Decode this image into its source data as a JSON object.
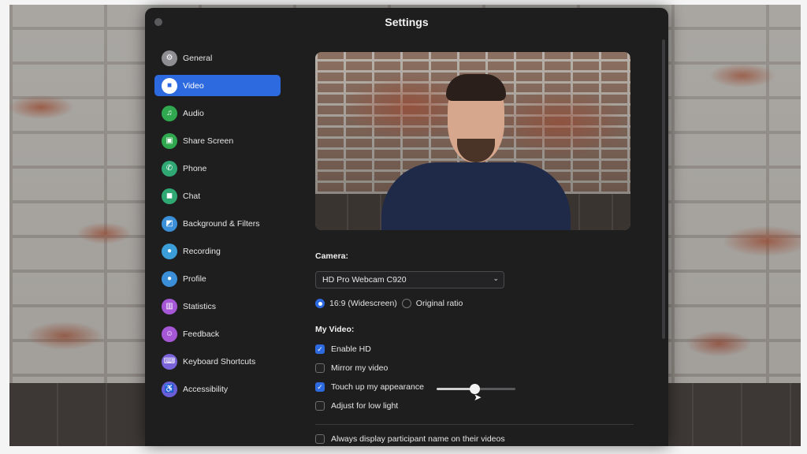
{
  "window": {
    "title": "Settings"
  },
  "sidebar": {
    "items": [
      {
        "label": "General",
        "icon": "gear-icon",
        "color": "#8e8e93",
        "glyph": "⚙",
        "active": false
      },
      {
        "label": "Video",
        "icon": "video-camera-icon",
        "color": "#2d6ae0",
        "glyph": "■",
        "active": true
      },
      {
        "label": "Audio",
        "icon": "headphones-icon",
        "color": "#2fa84f",
        "glyph": "♫",
        "active": false
      },
      {
        "label": "Share Screen",
        "icon": "share-screen-icon",
        "color": "#2fa84f",
        "glyph": "▣",
        "active": false
      },
      {
        "label": "Phone",
        "icon": "phone-icon",
        "color": "#2fa873",
        "glyph": "✆",
        "active": false
      },
      {
        "label": "Chat",
        "icon": "chat-bubble-icon",
        "color": "#2fa873",
        "glyph": "◼",
        "active": false
      },
      {
        "label": "Background & Filters",
        "icon": "person-background-icon",
        "color": "#3b8fd8",
        "glyph": "◩",
        "active": false
      },
      {
        "label": "Recording",
        "icon": "record-icon",
        "color": "#3b9ed8",
        "glyph": "●",
        "active": false
      },
      {
        "label": "Profile",
        "icon": "profile-icon",
        "color": "#3b8fd8",
        "glyph": "●",
        "active": false
      },
      {
        "label": "Statistics",
        "icon": "bar-chart-icon",
        "color": "#a557d6",
        "glyph": "▥",
        "active": false
      },
      {
        "label": "Feedback",
        "icon": "smiley-icon",
        "color": "#a557d6",
        "glyph": "☺",
        "active": false
      },
      {
        "label": "Keyboard Shortcuts",
        "icon": "keyboard-icon",
        "color": "#7a63d8",
        "glyph": "⌨",
        "active": false
      },
      {
        "label": "Accessibility",
        "icon": "accessibility-icon",
        "color": "#6a5fd8",
        "glyph": "♿",
        "active": false
      }
    ]
  },
  "video": {
    "camera_label": "Camera:",
    "camera_selected": "HD Pro Webcam C920",
    "ratio_widescreen": "16:9 (Widescreen)",
    "ratio_original": "Original ratio",
    "my_video_label": "My Video:",
    "enable_hd": "Enable HD",
    "mirror": "Mirror my video",
    "touch_up": "Touch up my appearance",
    "touch_up_level": 0.48,
    "low_light": "Adjust for low light",
    "always_display_names": "Always display participant name on their videos"
  }
}
